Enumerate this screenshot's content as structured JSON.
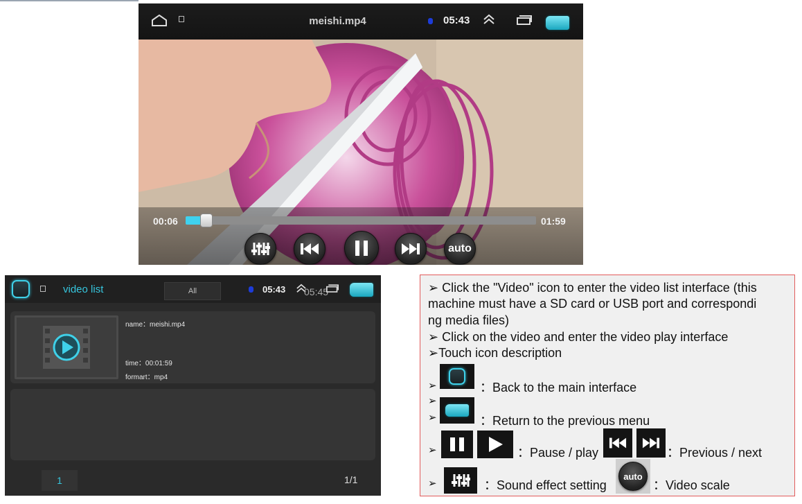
{
  "player": {
    "filename": "meishi.mp4",
    "status_time": "05:43",
    "current_time": "00:06",
    "duration": "01:59",
    "progress_fraction": 0.05,
    "auto_label": "auto",
    "accent": "#3fd2ef"
  },
  "videolist": {
    "title": "video list",
    "filter_all": "All",
    "status_time": "05:43",
    "ghost_time": "05:45",
    "item": {
      "name": "name：meishi.mp4",
      "time": "time：00:01:59",
      "format": "formart：mp4"
    },
    "page_button": "1",
    "page_count": "1/1"
  },
  "notes": {
    "line1a": "➢ Click the \"Video\" icon to enter the video list interface (this",
    "line1b": "machine must have a SD card or USB port and correspondi",
    "line1c": "ng media files)",
    "line2": "➢ Click on the video and enter the video play interface",
    "line3": "➢Touch icon description",
    "arrow": "➢",
    "back_main": "：Back to the main interface",
    "return_prev": "：Return to the previous menu",
    "pause_play": "：Pause / play",
    "prev_next": "：Previous / next",
    "sound_setting": "：Sound effect setting",
    "video_scale": "：Video scale",
    "auto_label": "auto"
  }
}
